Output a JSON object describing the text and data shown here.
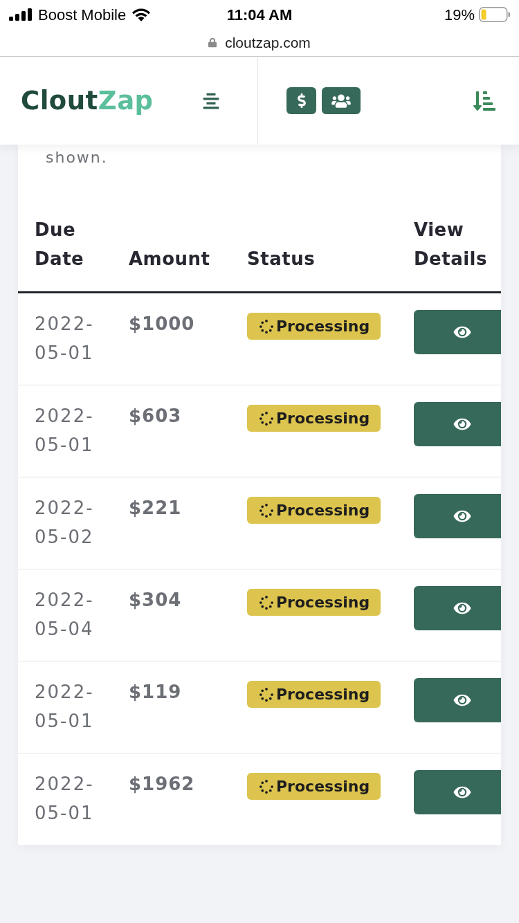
{
  "status_bar": {
    "carrier": "Boost Mobile",
    "time": "11:04 AM",
    "battery": "19%"
  },
  "address_bar": {
    "url": "cloutzap.com"
  },
  "header": {
    "logo": {
      "primary": "Clout",
      "accent": "Zap"
    }
  },
  "intro_text": "shown.",
  "table": {
    "columns": [
      "Due Date",
      "Amount",
      "Status",
      "View Details"
    ],
    "rows": [
      {
        "due_date": "2022-05-01",
        "amount": "$1000",
        "status": "Processing"
      },
      {
        "due_date": "2022-05-01",
        "amount": "$603",
        "status": "Processing"
      },
      {
        "due_date": "2022-05-02",
        "amount": "$221",
        "status": "Processing"
      },
      {
        "due_date": "2022-05-04",
        "amount": "$304",
        "status": "Processing"
      },
      {
        "due_date": "2022-05-01",
        "amount": "$119",
        "status": "Processing"
      },
      {
        "due_date": "2022-05-01",
        "amount": "$1962",
        "status": "Processing"
      }
    ]
  }
}
